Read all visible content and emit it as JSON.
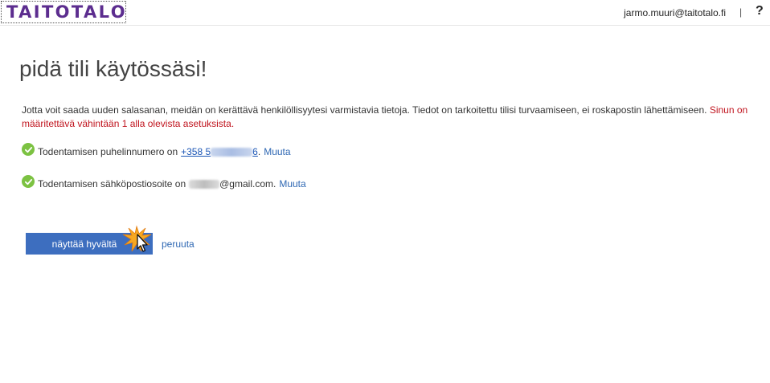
{
  "header": {
    "logo_text": "TAITOTALO",
    "user_email": "jarmo.muuri@taitotalo.fi",
    "separator": "|",
    "help_label": "?"
  },
  "main": {
    "title": "pidä tili käytössäsi!",
    "intro_text": "Jotta voit saada uuden salasanan, meidän on kerättävä henkilöllisyytesi varmistavia tietoja. Tiedot on tarkoitettu tilisi turvaamiseen, ei roskapostin lähettämiseen.",
    "intro_warning": "Sinun on määritettävä vähintään 1 alla olevista asetuksista.",
    "phone": {
      "label": "Todentamisen puhelinnumero on",
      "number_prefix": "+358 5",
      "number_suffix": "6",
      "change_label": "Muuta"
    },
    "email": {
      "label": "Todentamisen sähköpostiosoite on",
      "domain": "@gmail.com.",
      "change_label": "Muuta"
    },
    "confirm_button_label": "näyttää hyvältä",
    "cancel_label": "peruuta"
  },
  "colors": {
    "logo": "#5c2d8f",
    "warning": "#c0141e",
    "check": "#7cc242",
    "button": "#3d6ebf",
    "link": "#2f68b3"
  },
  "icons": {
    "verified": "check-circle-icon",
    "cursor": "mouse-pointer-icon",
    "click": "click-burst-icon"
  }
}
